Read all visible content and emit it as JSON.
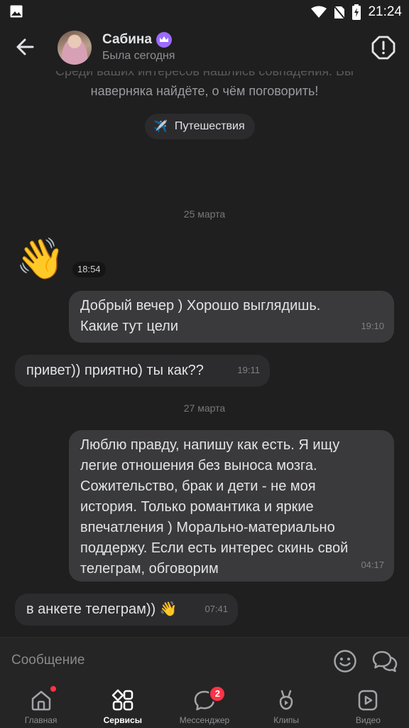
{
  "status_bar": {
    "time": "21:24"
  },
  "header": {
    "back_icon": "arrow-left-icon",
    "name": "Сабина",
    "status": "Была сегодня",
    "alert_icon": "alert-octagon-icon",
    "premium_icon": "crown-icon"
  },
  "chat": {
    "intro_line1": "Среди ваших интересов нашлись совпадения. Вы",
    "intro_line2": "наверняка найдёте, о чём поговорить!",
    "interest": {
      "emoji": "✈️",
      "label": "Путешествия"
    },
    "date1": "25 марта",
    "sticker": {
      "emoji": "👋",
      "time": "18:54"
    },
    "messages": [
      {
        "direction": "out",
        "text_lines": [
          "Добрый вечер ) Хорошо выглядишь.",
          "Какие тут цели"
        ],
        "time": "19:10"
      },
      {
        "direction": "in",
        "text_lines": [
          "привет)) приятно) ты как??"
        ],
        "time": "19:11"
      },
      {
        "direction": "out",
        "text_lines": [
          "Люблю правду, напишу как есть. Я ищу",
          "легие отношения без выноса мозга.",
          "Сожительство, брак и дети - не моя",
          "история. Только романтика и яркие",
          "впечатления ) Морально-материально",
          "поддержу. Если есть интерес скинь свой",
          "телеграм, обговорим"
        ],
        "time": "04:17"
      },
      {
        "direction": "in",
        "text_lines": [
          "в анкете телеграм)) 👋"
        ],
        "time": "07:41"
      }
    ],
    "date2": "27 марта"
  },
  "composer": {
    "placeholder": "Сообщение"
  },
  "tabs": [
    {
      "label": "Главная",
      "icon": "home-icon"
    },
    {
      "label": "Сервисы",
      "icon": "services-grid-icon",
      "active": true
    },
    {
      "label": "Мессенджер",
      "icon": "messenger-icon",
      "badge": "2"
    },
    {
      "label": "Клипы",
      "icon": "clips-icon"
    },
    {
      "label": "Видео",
      "icon": "video-icon"
    }
  ],
  "colors": {
    "background": "#1f1f1f",
    "bubble_out": "#3a3a3c",
    "bubble_in": "#2c2c2e",
    "accent_red": "#ff3347",
    "premium": "#9b6bff"
  }
}
